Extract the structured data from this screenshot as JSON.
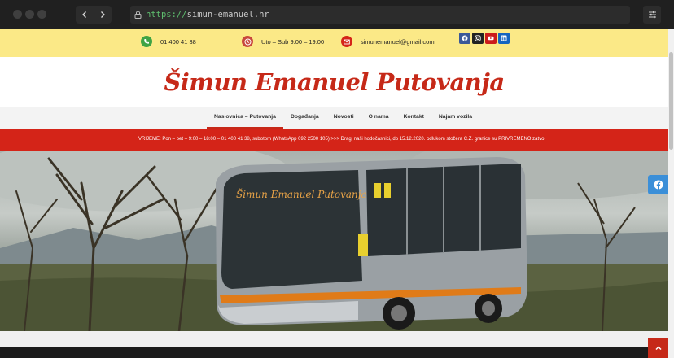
{
  "browser": {
    "url_protocol": "https://",
    "url_host": "simun-emanuel.hr"
  },
  "topbar": {
    "phone": "01 400 41 38",
    "hours": "Uto – Sub 9:00 – 19:00",
    "email": "simunemanuel@gmail.com",
    "social": [
      {
        "icon": "facebook-icon",
        "color": "#3b5998"
      },
      {
        "icon": "instagram-icon",
        "color": "#222222"
      },
      {
        "icon": "youtube-icon",
        "color": "#cc1b1b"
      },
      {
        "icon": "linkedin-icon",
        "color": "#1565c0"
      }
    ]
  },
  "logo": {
    "text": "Šimun Emanuel Putovanja"
  },
  "nav": {
    "items": [
      "Naslovnica – Putovanja",
      "Događanja",
      "Novosti",
      "O nama",
      "Kontakt",
      "Najam vozila"
    ],
    "active_index": 0
  },
  "ticker": {
    "text": "VRIJEME: Pon – pet – 9:00 – 18:00 – 01 400 41 38, subotom (WhatsApp 092 2500 105) >>> Dragi naši hodočasnici, do 15.12.2020. odlukom stožera C.Z. granice su PRIVREMENO zatvo"
  },
  "hero": {
    "bus_sign": "Šimun Emanuel Putovanja"
  },
  "colors": {
    "accent": "#c62918",
    "topbar_bg": "#fbe987",
    "ticker_bg": "#d42418"
  }
}
